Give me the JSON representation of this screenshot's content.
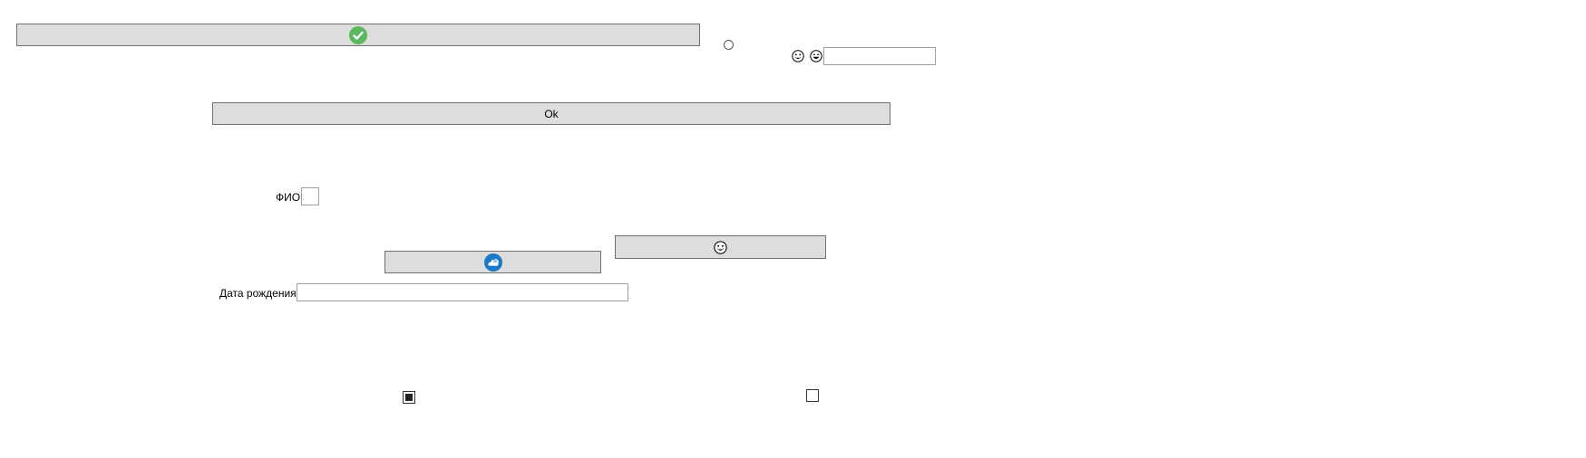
{
  "top_button": {
    "icon": "check-circle-icon",
    "icon_color": "#5cb85c"
  },
  "radio": {
    "checked": false
  },
  "emoji_row": {
    "icons": [
      "grinning-face-icon",
      "laughing-face-icon"
    ],
    "input_value": ""
  },
  "ok_button": {
    "label": "Ok"
  },
  "fio": {
    "label": "ФИО",
    "value": ""
  },
  "emoji_button": {
    "icon": "smiling-face-icon"
  },
  "cloud_button": {
    "icon": "cloud-icon",
    "icon_color": "#1e78c8"
  },
  "birth_date": {
    "label": "Дата рождения",
    "value": ""
  },
  "checkboxes": [
    {
      "state": "indeterminate"
    },
    {
      "state": "unchecked"
    }
  ]
}
